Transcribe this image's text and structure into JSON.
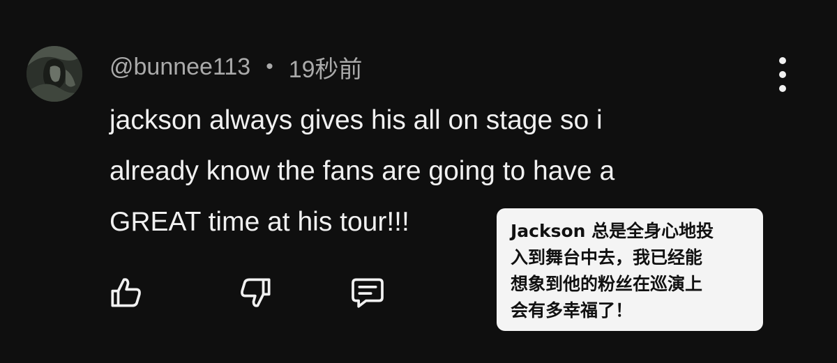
{
  "comment": {
    "author": "@bunnee113",
    "separator": "•",
    "timestamp": "19秒前",
    "text_lines": [
      "jackson always gives his all on stage so i",
      "already know the fans are going to have a",
      "GREAT time at his tour!!!"
    ]
  },
  "actions": {
    "like_icon": "thumbs-up-icon",
    "dislike_icon": "thumbs-down-icon",
    "reply_icon": "comment-reply-icon",
    "more_icon": "more-vertical-icon"
  },
  "translation": {
    "lines": [
      "Jackson 总是全身心地投",
      "入到舞台中去，我已经能",
      "想象到他的粉丝在巡演上",
      "会有多幸福了！"
    ]
  },
  "colors": {
    "background": "#0f0f0f",
    "text_primary": "#f1f1f1",
    "text_secondary": "#aaaaaa",
    "translation_bg": "#f4f4f4"
  }
}
